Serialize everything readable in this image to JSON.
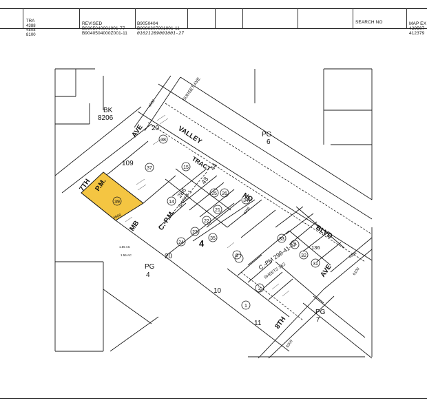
{
  "header": {
    "tra": [
      "TRA",
      "4388",
      "4808",
      "8100"
    ],
    "revised": [
      "REVISED",
      "B9305040001001-77",
      "B9040504000Z001-11"
    ],
    "numbers": [
      "B9050404",
      "B9090307001001-11"
    ],
    "handwritten": "01021289001001-27",
    "search_label": "SEARCH NO",
    "map_ex": [
      "MAP EX",
      "429567",
      "412379"
    ]
  },
  "map": {
    "blocks": {
      "bk": "BK",
      "bk_num": "8206",
      "pg6": "PG",
      "pg6_num": "6",
      "pg4": "PG",
      "pg4_num": "4",
      "pg7": "PG",
      "pg7_num": "7",
      "big4": "4",
      "big10": "10",
      "big11": "11",
      "blk20": "20",
      "blk20b": "20",
      "blk109": "109"
    },
    "streets": {
      "sunset": "SUNSET AVE",
      "valley": "VALLEY",
      "seventh": "7TH",
      "ave": "AVE",
      "blvd": "BLVD",
      "eighth": "8TH",
      "ave2": "AVE",
      "no": "NO",
      "mb": "MB",
      "pm": "P.M.",
      "cpm": "C.-P.M.",
      "tract": "TRACT"
    },
    "parcels": [
      "39",
      "38",
      "37",
      "15",
      "14",
      "24",
      "23",
      "22",
      "21",
      "25",
      "26",
      "34",
      "33",
      "35",
      "36",
      "9",
      "2",
      "1",
      "7",
      "32",
      "31",
      "3"
    ],
    "labels": {
      "sheet": "SHEET 1",
      "cpm_num": "286",
      "cpm_num2": "43",
      "cpm_num3": "44",
      "lower_cpm": "C.-PM 298-41-42",
      "sheets": "SHEETS 1&2",
      "num4386": "4386",
      "num4388": "4388",
      "num4300": "4300",
      "num136": "136",
      "num4608": "4608",
      "num6100": "6100",
      "num6300": "6300",
      "ac": "1.55 AC",
      "ac2": "1.56 AC"
    }
  },
  "colors": {
    "highlight": "#f4c542",
    "line": "#1a1a1a"
  }
}
